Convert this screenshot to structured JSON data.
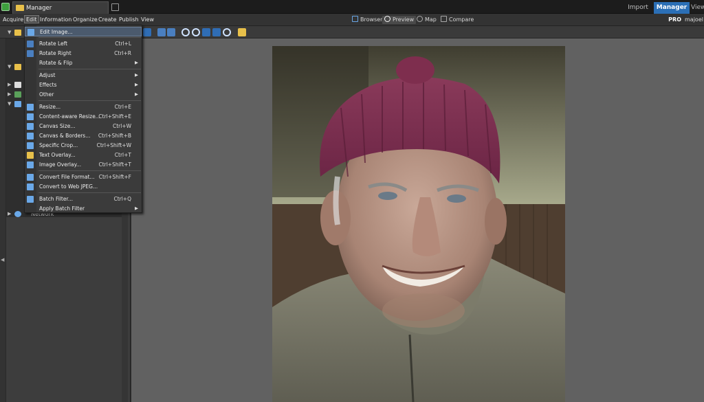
{
  "titlebar": {
    "doc_tab": "Manager",
    "mode_tabs": [
      {
        "label": "Import",
        "active": false
      },
      {
        "label": "Manager",
        "active": true
      },
      {
        "label": "View",
        "active": false
      }
    ]
  },
  "menubar": {
    "items": [
      "Acquire",
      "Edit",
      "Information",
      "Organize",
      "Create",
      "Publish",
      "View"
    ],
    "open_item": "Edit",
    "view_tools": [
      {
        "label": "Browser",
        "icon": "browser-icon",
        "active": false
      },
      {
        "label": "Preview",
        "icon": "magnifier-icon",
        "active": true
      },
      {
        "label": "Map",
        "icon": "globe-icon",
        "active": false
      },
      {
        "label": "Compare",
        "icon": "compare-icon",
        "active": false
      }
    ],
    "edition": "PRO",
    "user": "majoel"
  },
  "edit_menu": [
    {
      "label": "Edit Image...",
      "shortcut": "",
      "submenu": false,
      "icon": "edit-image-icon",
      "highlighted": true
    },
    {
      "label": "Rotate Left",
      "shortcut": "Ctrl+L",
      "submenu": false,
      "icon": "rotate-left-icon"
    },
    {
      "label": "Rotate Right",
      "shortcut": "Ctrl+R",
      "submenu": false,
      "icon": "rotate-right-icon"
    },
    {
      "label": "Rotate & Flip",
      "shortcut": "",
      "submenu": true,
      "icon": ""
    },
    {
      "label": "Adjust",
      "shortcut": "",
      "submenu": true,
      "icon": ""
    },
    {
      "label": "Effects",
      "shortcut": "",
      "submenu": true,
      "icon": ""
    },
    {
      "label": "Other",
      "shortcut": "",
      "submenu": true,
      "icon": ""
    },
    {
      "label": "Resize...",
      "shortcut": "Ctrl+E",
      "submenu": false,
      "icon": "resize-icon"
    },
    {
      "label": "Content-aware Resize...",
      "shortcut": "Ctrl+Shift+E",
      "submenu": false,
      "icon": "content-aware-resize-icon"
    },
    {
      "label": "Canvas Size...",
      "shortcut": "Ctrl+W",
      "submenu": false,
      "icon": "canvas-size-icon"
    },
    {
      "label": "Canvas & Borders...",
      "shortcut": "Ctrl+Shift+B",
      "submenu": false,
      "icon": "canvas-borders-icon"
    },
    {
      "label": "Specific Crop...",
      "shortcut": "Ctrl+Shift+W",
      "submenu": false,
      "icon": "crop-icon"
    },
    {
      "label": "Text Overlay...",
      "shortcut": "Ctrl+T",
      "submenu": false,
      "icon": "text-overlay-icon"
    },
    {
      "label": "Image Overlay...",
      "shortcut": "Ctrl+Shift+T",
      "submenu": false,
      "icon": "image-overlay-icon"
    },
    {
      "label": "Convert File Format...",
      "shortcut": "Ctrl+Shift+F",
      "submenu": false,
      "icon": "convert-format-icon"
    },
    {
      "label": "Convert to Web JPEG...",
      "shortcut": "",
      "submenu": false,
      "icon": "web-jpeg-icon"
    },
    {
      "label": "Batch Filter...",
      "shortcut": "Ctrl+Q",
      "submenu": false,
      "icon": "batch-filter-icon"
    },
    {
      "label": "Apply Batch Filter",
      "shortcut": "",
      "submenu": true,
      "icon": ""
    }
  ],
  "tree": {
    "network_label": "Network"
  },
  "colors": {
    "accent": "#2b6fb6",
    "menu_bg": "#3b3b3b",
    "panel_bg": "#3d3d3d",
    "viewer_bg": "#616161"
  }
}
